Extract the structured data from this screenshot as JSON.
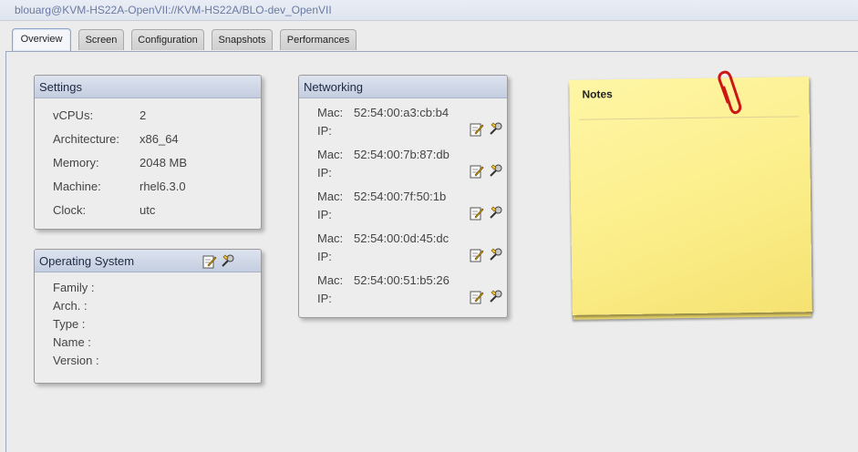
{
  "window": {
    "title": "blouarg@KVM-HS22A-OpenVII://KVM-HS22A/BLO-dev_OpenVII"
  },
  "tabs": [
    {
      "label": "Overview",
      "active": true
    },
    {
      "label": "Screen"
    },
    {
      "label": "Configuration"
    },
    {
      "label": "Snapshots"
    },
    {
      "label": "Performances"
    }
  ],
  "settings": {
    "title": "Settings",
    "rows": [
      {
        "label": "vCPUs:",
        "value": "2"
      },
      {
        "label": "Architecture:",
        "value": "x86_64"
      },
      {
        "label": "Memory:",
        "value": "2048 MB"
      },
      {
        "label": "Machine:",
        "value": "rhel6.3.0"
      },
      {
        "label": "Clock:",
        "value": "utc"
      }
    ]
  },
  "os": {
    "title": "Operating System",
    "rows": [
      {
        "label": "Family :"
      },
      {
        "label": "Arch. :"
      },
      {
        "label": "Type :"
      },
      {
        "label": "Name :"
      },
      {
        "label": "Version :"
      }
    ],
    "icons": [
      "edit-icon",
      "wrench-icon"
    ]
  },
  "networking": {
    "title": "Networking",
    "mac_label": "Mac:",
    "ip_label": "IP:",
    "interfaces": [
      {
        "mac": "52:54:00:a3:cb:b4"
      },
      {
        "mac": "52:54:00:7b:87:db"
      },
      {
        "mac": "52:54:00:7f:50:1b"
      },
      {
        "mac": "52:54:00:0d:45:dc"
      },
      {
        "mac": "52:54:00:51:b5:26"
      }
    ]
  },
  "notes": {
    "title": "Notes"
  },
  "colors": {
    "header_gradient_top": "#dde3ef",
    "header_gradient_bottom": "#c4cee0",
    "note_yellow": "#fbee8a",
    "paperclip_red": "#d11a1a"
  }
}
